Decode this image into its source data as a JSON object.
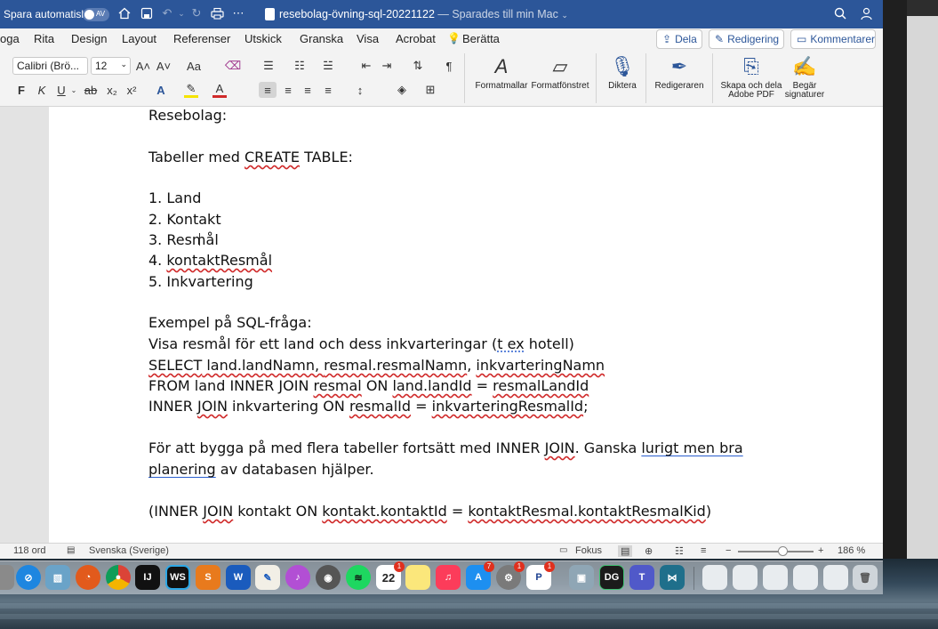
{
  "titlebar": {
    "autosave_label": "Spara automatiskt",
    "autosave_state": "AV",
    "document_name": "resebolag-övning-sql-20221122",
    "save_status": "— Sparades till min Mac"
  },
  "tabs": [
    "oga",
    "Rita",
    "Design",
    "Layout",
    "Referenser",
    "Utskick",
    "Granska",
    "Visa",
    "Acrobat",
    "Berätta"
  ],
  "tab_actions": {
    "share": "Dela",
    "editing": "Redigering",
    "comments": "Kommentarer"
  },
  "ribbon": {
    "font_name": "Calibri (Brö...",
    "font_size": "12",
    "grow_font": "A˄",
    "shrink_font": "A˅",
    "change_case": "Aa",
    "bold": "F",
    "italic": "K",
    "underline": "U",
    "strikethrough": "ab",
    "subscript": "x₂",
    "superscript": "x²",
    "styles": "Formatmallar",
    "styles_pane": "Formatfönstret",
    "dictate": "Diktera",
    "editor": "Redigeraren",
    "create_pdf_line1": "Skapa och dela",
    "create_pdf_line2": "Adobe PDF",
    "request_signatures_line1": "Begär",
    "request_signatures_line2": "signaturer"
  },
  "document": {
    "heading": "Resebolag:",
    "tables_intro": [
      "Tabeller med ",
      "CREATE",
      " TABLE:"
    ],
    "list": [
      "1. Land",
      "2. Kontakt",
      "3. Resmål",
      "4. ",
      "kontaktResmål",
      "5. Inkvartering"
    ],
    "example_title": "Exempel på SQL-fråga:",
    "example_desc": [
      "Visa resmål för ett land och dess inkvarteringar (",
      "t ex",
      " hotell)"
    ],
    "select_line": [
      "SELECT",
      " land.landNamn, ",
      "resmal.resmalNamn",
      ", ",
      "inkvarteringNamn"
    ],
    "from_line": [
      "FROM land INNER JOIN ",
      "resmal",
      " ON ",
      "land.landId",
      " = ",
      "resmalLandId"
    ],
    "inner_line": [
      "INNER ",
      "JOIN",
      " inkvartering ON ",
      "resmalId",
      " = ",
      "inkvarteringResmalId",
      ";"
    ],
    "para_line1": [
      "För att bygga på med flera tabeller fortsätt med INNER ",
      "JOIN",
      ". Ganska ",
      "lurigt men bra"
    ],
    "para_line2": [
      "planering",
      " av databasen hjälper."
    ],
    "join_line": [
      "(INNER ",
      "JOIN",
      " kontakt ON ",
      "kontakt.kontaktId",
      " = ",
      "kontaktResmal.kontaktResmalKid",
      ")"
    ]
  },
  "statusbar": {
    "word_count": "118 ord",
    "language": "Svenska (Sverige)",
    "focus": "Fokus",
    "zoom_minus": "−",
    "zoom_plus": "+",
    "zoom_level": "186 %"
  },
  "dock": {
    "badges": {
      "calendar_date": "22",
      "calendar_badge": "1",
      "appstore_badge": "7",
      "settings_badge": "1",
      "pdf_badge": "1"
    },
    "labels": {
      "intellij": "IJ",
      "webstorm": "WS",
      "word": "W",
      "datagrip": "DG"
    }
  },
  "colors": {
    "word_blue": "#2c5699",
    "spell_red": "#d02a2a",
    "grammar_blue": "#2a5fcf"
  }
}
